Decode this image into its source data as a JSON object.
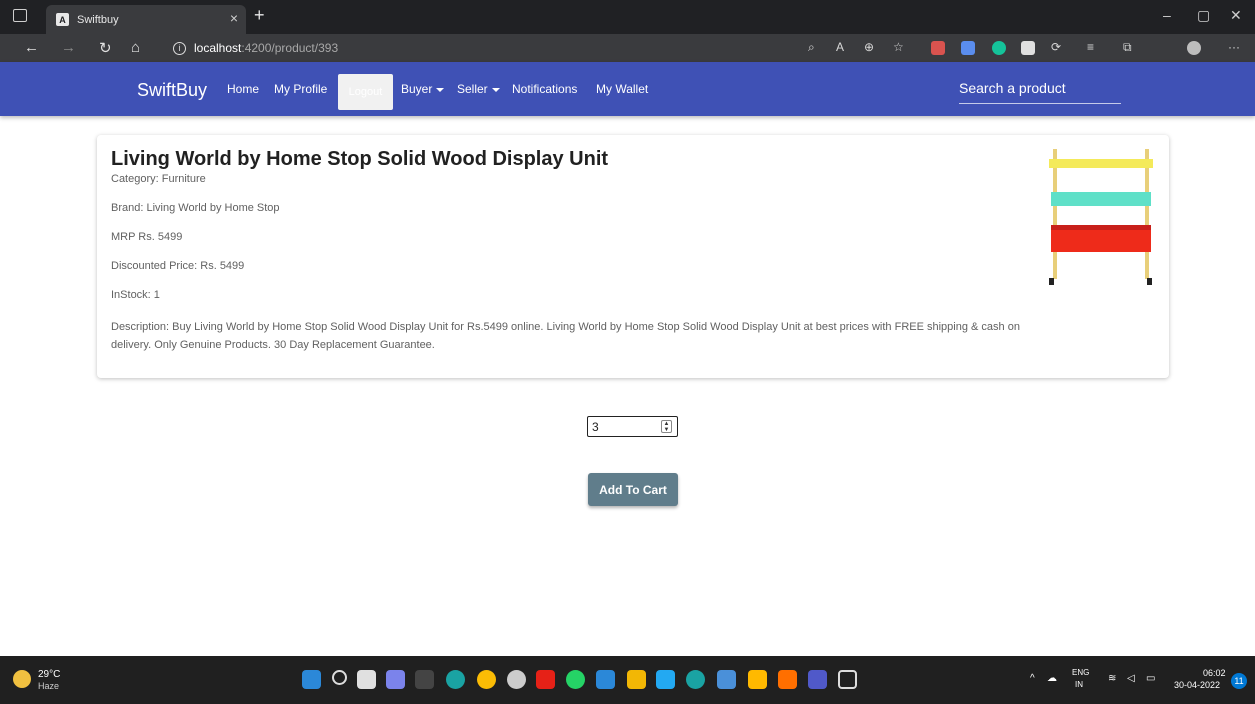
{
  "browser": {
    "tab_title": "Swiftbuy",
    "tab_favicon": "A",
    "new_tab_symbol": "+",
    "url_host": "localhost",
    "url_path": ":4200/product/393"
  },
  "navbar": {
    "brand": "SwiftBuy",
    "links": {
      "home": "Home",
      "profile": "My Profile",
      "logout": "Logout",
      "buyer": "Buyer",
      "seller": "Seller",
      "notifications": "Notifications",
      "wallet": "My Wallet"
    },
    "search_placeholder": "Search a product"
  },
  "product": {
    "name": "Living World by Home Stop Solid Wood Display Unit",
    "category": "Category: Furniture",
    "brand": "Brand: Living World by Home Stop",
    "mrp": "MRP Rs. 5499",
    "discounted": "Discounted Price: Rs. 5499",
    "stock": "InStock: 1",
    "description": "Description: Buy Living World by Home Stop Solid Wood Display Unit for Rs.5499 online. Living World by Home Stop Solid Wood Display Unit at best prices with FREE shipping & cash on delivery. Only Genuine Products. 30 Day Replacement Guarantee."
  },
  "cart": {
    "quantity": "3",
    "add_label": "Add To Cart"
  },
  "taskbar": {
    "temperature": "29°C",
    "weather": "Haze",
    "lang_line1": "ENG",
    "lang_line2": "IN",
    "time": "06:02",
    "date": "30-04-2022",
    "notification_count": "11"
  },
  "colors": {
    "navbar": "#3f51b5",
    "cart_button": "#607d8b"
  }
}
